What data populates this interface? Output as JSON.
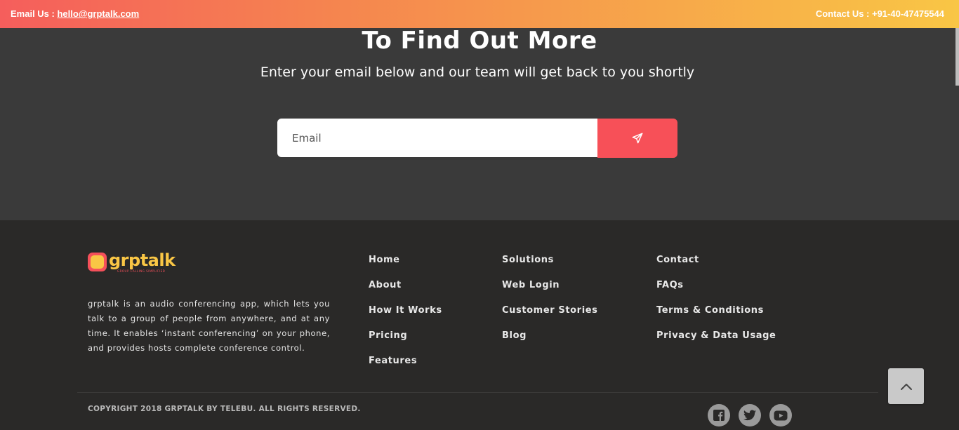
{
  "topbar": {
    "email_label": "Email Us :",
    "email": "hello@grptalk.com",
    "contact": "Contact Us : +91-40-47475544"
  },
  "subscribe": {
    "title": "To Find Out More",
    "subtitle": "Enter your email below and our team will get back to you shortly",
    "email_placeholder": "Email",
    "send_icon": "paper-plane-icon"
  },
  "footer": {
    "logo_text": "grptalk",
    "logo_tagline": "GROUP CALLING SIMPLIFIED",
    "about": "grptalk is an audio conferencing app, which lets you talk to a group of people from anywhere, and at any time. It enables ‘instant conferencing’ on your phone, and provides hosts complete conference control.",
    "col1": [
      "Home",
      "About",
      "How It Works",
      "Pricing",
      "Features"
    ],
    "col2": [
      "Solutions",
      "Web Login",
      "Customer Stories",
      "Blog"
    ],
    "col3": [
      "Contact",
      "FAQs",
      "Terms & Conditions",
      "Privacy & Data Usage"
    ],
    "copyright": "COPYRIGHT 2018 GRPTALK BY TELEBU. ALL RIGHTS RESERVED.",
    "social": [
      "facebook-icon",
      "twitter-icon",
      "youtube-icon"
    ]
  },
  "colors": {
    "accent": "#f75058",
    "brand_yellow": "#f9c645",
    "subscribe_bg": "#3a3a3a",
    "footer_bg": "#2a2928"
  }
}
